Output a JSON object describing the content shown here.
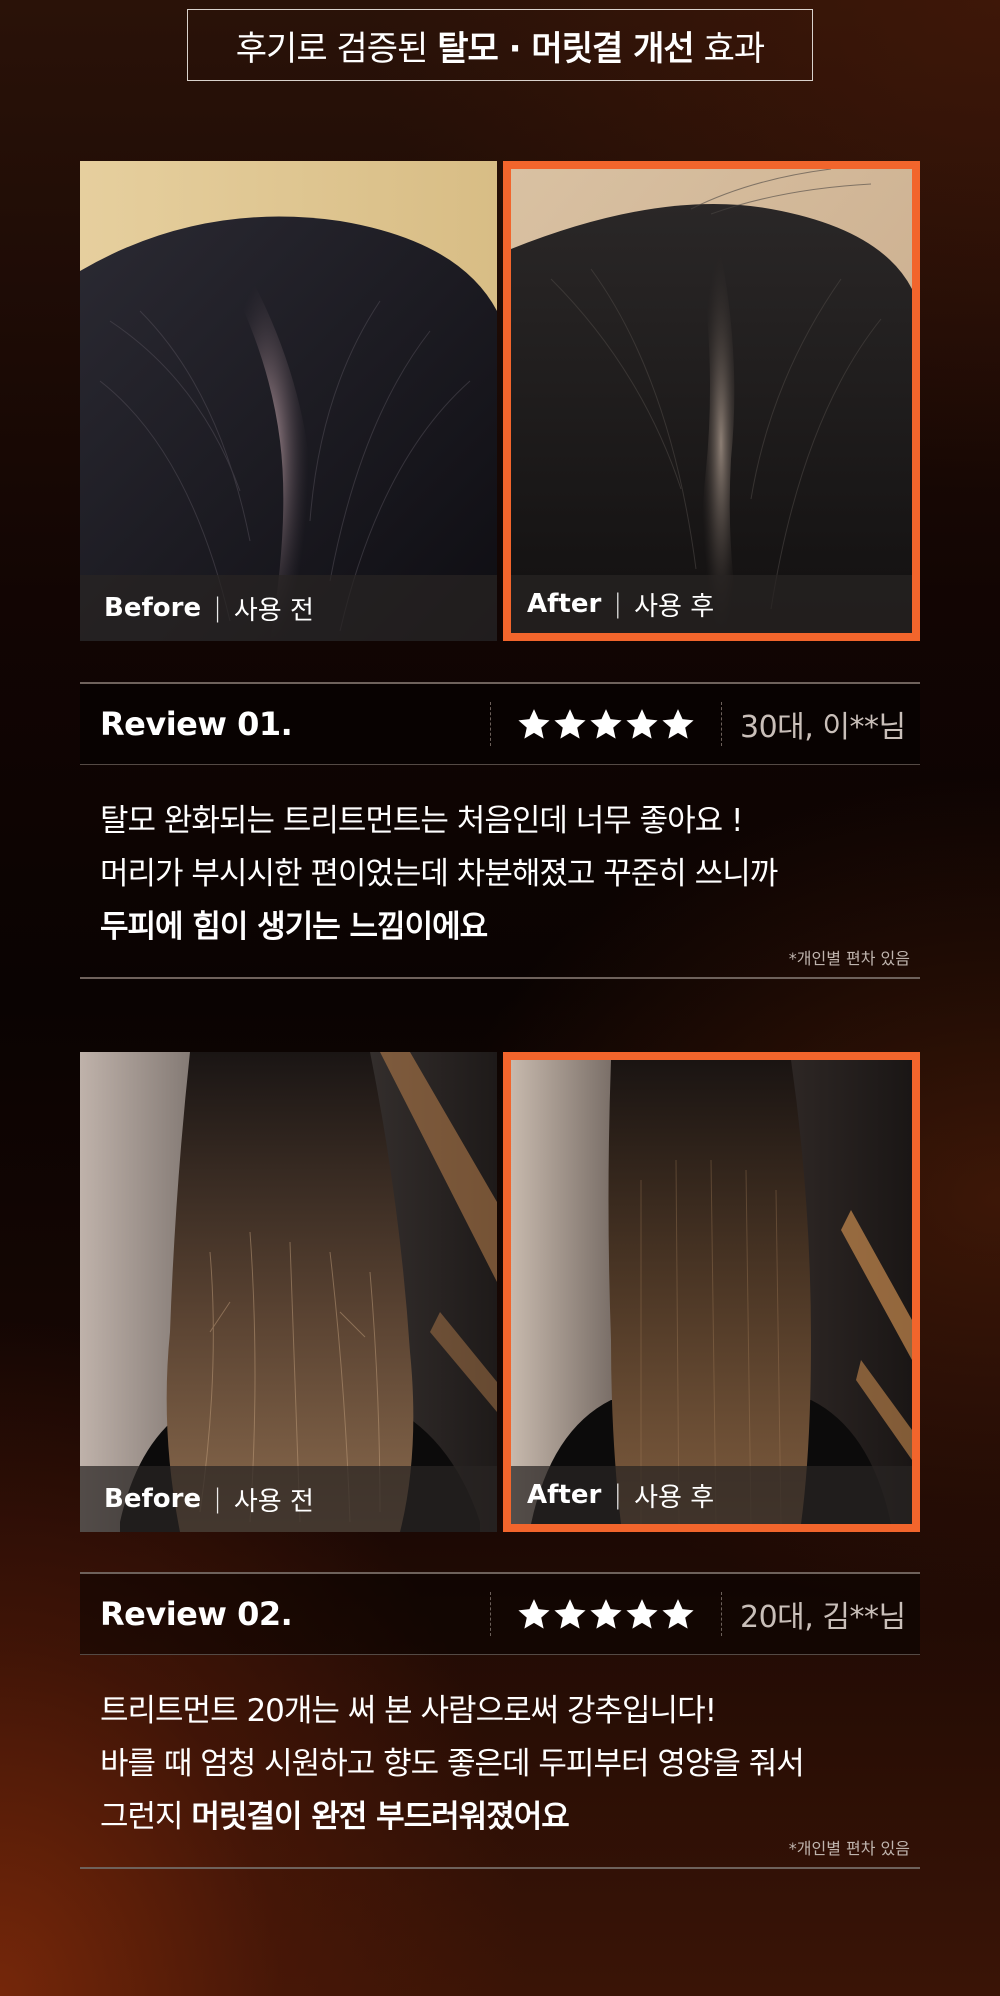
{
  "header": {
    "prefix": "후기로 검증된",
    "highlight": "탈모 · 머릿결 개선",
    "suffix": "효과"
  },
  "reviews": [
    {
      "before_label": {
        "en": "Before",
        "sep": "|",
        "ko": "사용 전"
      },
      "after_label": {
        "en": "After",
        "sep": "|",
        "ko": "사용 후"
      },
      "title": "Review 01.",
      "rating": 5,
      "meta": "30대, 이**님",
      "lines": {
        "l1": "탈모 완화되는 트리트먼트는 처음인데 너무 좋아요 !",
        "l2": "머리가 부시시한 편이었는데 차분해졌고 꾸준히 쓰니까",
        "l3_bold": "두피에 힘이 생기는 느낌이에요"
      },
      "disclaimer": "*개인별 편차 있음"
    },
    {
      "before_label": {
        "en": "Before",
        "sep": "|",
        "ko": "사용 전"
      },
      "after_label": {
        "en": "After",
        "sep": "|",
        "ko": "사용 후"
      },
      "title": "Review 02.",
      "rating": 5,
      "meta": "20대, 김**님",
      "lines": {
        "l1": "트리트먼트 20개는 써 본 사람으로써 강추입니다!",
        "l2": "바를 때 엄청 시원하고 향도 좋은데 두피부터 영양을 줘서",
        "l3_plain": "그런지",
        "l3_bold": "머릿결이 완전 부드러워졌어요"
      },
      "disclaimer": "*개인별 편차 있음"
    }
  ],
  "colors": {
    "accent": "#f2652c",
    "star": "#ffffff",
    "meta_text": "#c9bfb9"
  }
}
